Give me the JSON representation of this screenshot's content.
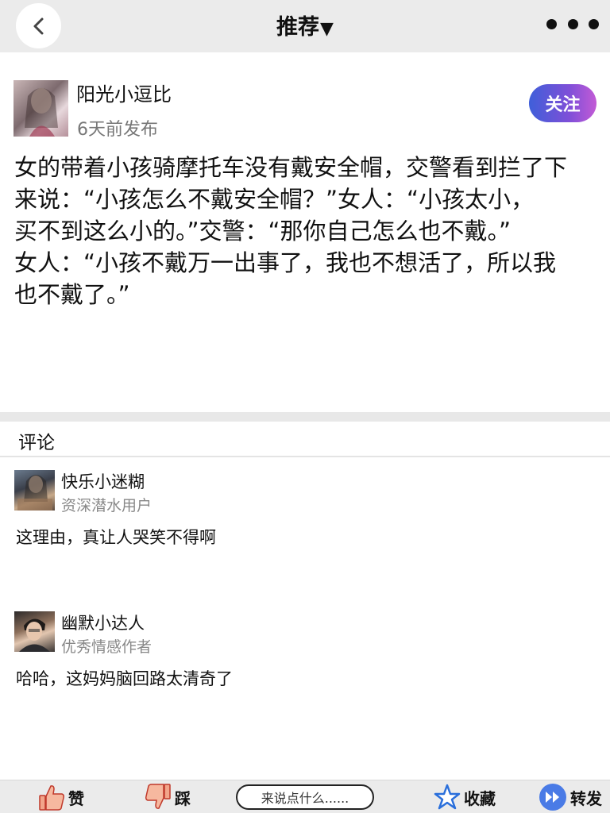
{
  "nav": {
    "title": "推荐",
    "title_caret": "▼",
    "back_icon": "chevron-left-icon",
    "more_icon": "more-dots-icon"
  },
  "author": {
    "name": "阳光小逗比",
    "time": "6天前发布",
    "follow_label": "关注"
  },
  "post": {
    "lines": [
      "女的带着小孩骑摩托车没有戴安全帽，交警看到拦了下",
      "来说：“小孩怎么不戴安全帽？”女人：“小孩太小，",
      "买不到这么小的。”交警：“那你自己怎么也不戴。”",
      "女人：“小孩不戴万一出事了，我也不想活了，所以我",
      "也不戴了。”"
    ]
  },
  "comments_section": {
    "title": "评论",
    "items": [
      {
        "name": "快乐小迷糊",
        "badge": "资深潜水用户",
        "text": "这理由，真让人哭笑不得啊"
      },
      {
        "name": "幽默小达人",
        "badge": "优秀情感作者",
        "text": "哈哈，这妈妈脑回路太清奇了"
      }
    ]
  },
  "bottom_bar": {
    "like_label": "赞",
    "dislike_label": "踩",
    "comment_placeholder": "来说点什么......",
    "favorite_label": "收藏",
    "share_label": "转发"
  },
  "colors": {
    "nav_bg": "#ebebeb",
    "follow_gradient_start": "#3f5fd9",
    "follow_gradient_end": "#c35bd6",
    "like_icon": "#f2a58a",
    "favorite_icon": "#2a6fdb",
    "share_icon": "#4a7be6"
  }
}
